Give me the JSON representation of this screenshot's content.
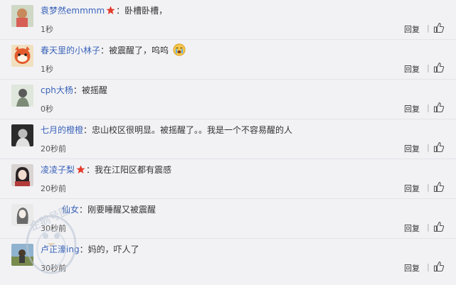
{
  "comments": [
    {
      "user": "袁梦然emmmm",
      "badge": "star-badge-icon",
      "separator": "：",
      "text": "卧槽卧槽，",
      "time": "1秒",
      "reply": "回复"
    },
    {
      "user": "春天里的小林子",
      "separator": "：",
      "text": "被震醒了，呜呜",
      "emoji": "crying-emoji-icon",
      "time": "1秒",
      "reply": "回复"
    },
    {
      "user": "cph大杨",
      "separator": "：",
      "text": "被摇醒",
      "time": "0秒",
      "reply": "回复"
    },
    {
      "user": "七月的橙橙",
      "separator": "：",
      "text": "忠山校区很明显。被摇醒了。。我是一个不容易醒的人",
      "time": "20秒前",
      "reply": "回复"
    },
    {
      "user": "凌凌子梨",
      "badge": "star-badge-icon",
      "separator": "：",
      "text": "我在江阳区都有震感",
      "time": "20秒前",
      "reply": "回复"
    },
    {
      "user": "仙女",
      "separator": "：",
      "text": "刚要睡醒又被震醒",
      "time": "30秒前",
      "reply": "回复"
    },
    {
      "user": "卢正濠ing",
      "separator": "：",
      "text": "妈的，吓人了",
      "time": "30秒前",
      "reply": "回复"
    }
  ],
  "reply_separator": "|",
  "icons": {
    "like": "thumbs-up-icon",
    "star": "star-badge-icon",
    "watermark": "penguin-watermark-logo"
  },
  "watermark_text": "企鹅号图",
  "colors": {
    "username": "#3a63b8",
    "star": "#e23c2c",
    "background": "#f2f2f5"
  }
}
